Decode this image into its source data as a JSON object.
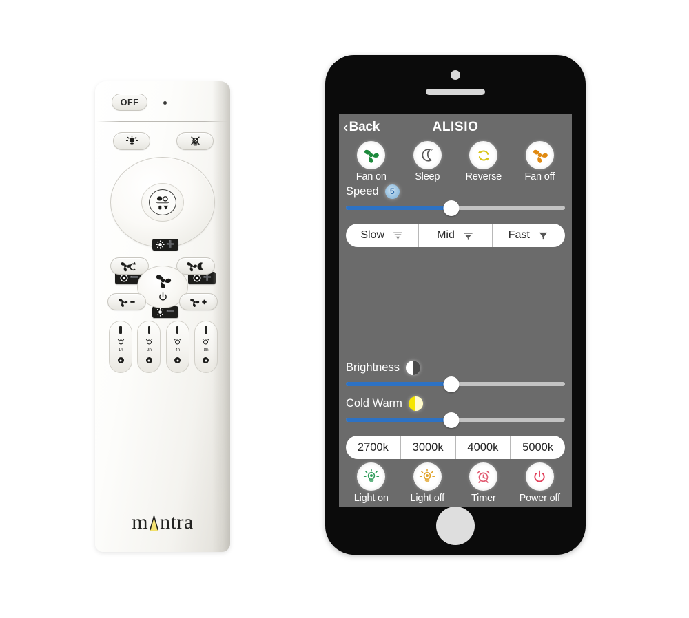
{
  "remote": {
    "brand": "mantra",
    "off_button": "OFF",
    "led_indicator": "led-dot",
    "light_on_button": "light-on",
    "light_off_button": "light-off",
    "dial": {
      "up": "brightness-up",
      "down": "brightness-down",
      "left": "color-temp-down",
      "right": "color-temp-up",
      "center": "light-mode"
    },
    "fan": {
      "reverse": "fan-reverse",
      "sleep": "fan-sleep",
      "speed_down": "fan-speed-down",
      "speed_up": "fan-speed-up",
      "power": "fan-power"
    },
    "timers": [
      {
        "label": "1h"
      },
      {
        "label": "2h"
      },
      {
        "label": "4h"
      },
      {
        "label": "8h"
      }
    ]
  },
  "phone": {
    "nav": {
      "back_label": "Back",
      "back_chevron": "‹",
      "title": "ALISIO"
    },
    "fan_icons": [
      {
        "label": "Fan on",
        "icon": "fan-icon",
        "color": "#1d8a3c"
      },
      {
        "label": "Sleep",
        "icon": "moon-zzz-icon",
        "color": "#5a5a5a"
      },
      {
        "label": "Reverse",
        "icon": "refresh-icon",
        "color": "#d8c516"
      },
      {
        "label": "Fan off",
        "icon": "fan-icon",
        "color": "#e08a12"
      }
    ],
    "speed": {
      "label": "Speed",
      "badge_value": "5",
      "badge_icon": "speed-badge-icon",
      "value_percent": 48
    },
    "speed_presets": [
      {
        "label": "Slow",
        "icon": "fan-slow-icon"
      },
      {
        "label": "Mid",
        "icon": "fan-mid-icon"
      },
      {
        "label": "Fast",
        "icon": "fan-fast-icon"
      }
    ],
    "brightness": {
      "label": "Brightness",
      "badge_icon": "half-circle-icon",
      "value_percent": 48
    },
    "cold_warm": {
      "label": "Cold Warm",
      "badge_icon": "half-circle-yellow-icon",
      "value_percent": 48
    },
    "kelvin_presets": [
      "2700k",
      "3000k",
      "4000k",
      "5000k"
    ],
    "bottom_icons": [
      {
        "label": "Light on",
        "icon": "bulb-on-icon",
        "color": "#2f9c5a"
      },
      {
        "label": "Light off",
        "icon": "bulb-off-icon",
        "color": "#e0a227"
      },
      {
        "label": "Timer",
        "icon": "alarm-icon",
        "color": "#e25c72"
      },
      {
        "label": "Power off",
        "icon": "power-icon",
        "color": "#e2415c"
      }
    ]
  },
  "colors": {
    "slider_fill": "#2d72c4",
    "slider_rail": "#c3c3c3",
    "screen_bg": "#6b6b6b",
    "phone_body": "#0b0b0b",
    "brand_accent": "#f2e06a"
  }
}
